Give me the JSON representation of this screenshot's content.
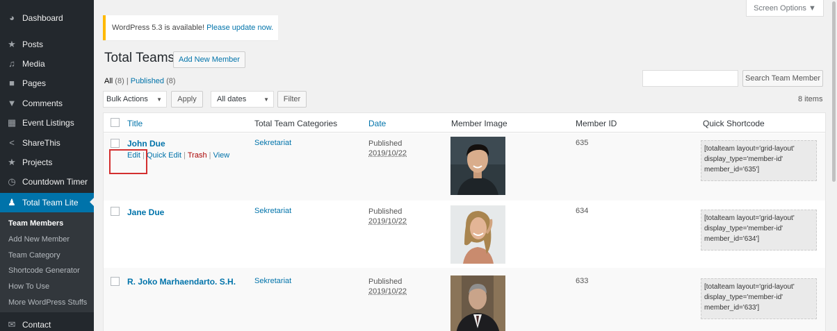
{
  "sidebar": {
    "items": [
      {
        "label": "Dashboard",
        "icon": "dashboard-icon",
        "glyph": "◕"
      },
      {
        "label": "Posts",
        "icon": "pin-icon",
        "glyph": "★"
      },
      {
        "label": "Media",
        "icon": "media-icon",
        "glyph": "♫"
      },
      {
        "label": "Pages",
        "icon": "pages-icon",
        "glyph": "■"
      },
      {
        "label": "Comments",
        "icon": "comment-icon",
        "glyph": "▼"
      },
      {
        "label": "Event Listings",
        "icon": "calendar-icon",
        "glyph": "▦"
      },
      {
        "label": "ShareThis",
        "icon": "share-icon",
        "glyph": "<"
      },
      {
        "label": "Projects",
        "icon": "pin-icon",
        "glyph": "★"
      },
      {
        "label": "Countdown Timer",
        "icon": "clock-icon",
        "glyph": "◷"
      },
      {
        "label": "Total Team Lite",
        "icon": "user-icon",
        "glyph": "♟"
      }
    ],
    "submenu": [
      "Team Members",
      "Add New Member",
      "Team Category",
      "Shortcode Generator",
      "How To Use",
      "More WordPress Stuffs"
    ],
    "bottom": {
      "label": "Contact",
      "icon": "mail-icon",
      "glyph": "✉"
    }
  },
  "screen_options": "Screen Options ▼",
  "notice": {
    "text": "WordPress 5.3 is available!",
    "link": "Please update now."
  },
  "header": {
    "title": "Total Teams",
    "add_new": "Add New Member"
  },
  "filters": {
    "all": "All",
    "all_count": "(8)",
    "separator": "|",
    "published": "Published",
    "published_count": "(8)",
    "bulk_actions": "Bulk Actions",
    "apply": "Apply",
    "all_dates": "All dates",
    "filter": "Filter",
    "search_button": "Search Team Member",
    "search_value": "",
    "items_count": "8 items"
  },
  "columns": {
    "title": "Title",
    "categories": "Total Team Categories",
    "date": "Date",
    "image": "Member Image",
    "id": "Member ID",
    "shortcode": "Quick Shortcode"
  },
  "row_actions": {
    "edit": "Edit",
    "quick_edit": "Quick Edit",
    "trash": "Trash",
    "view": "View",
    "sep": "|"
  },
  "rows": [
    {
      "name": "John Due",
      "category": "Sekretariat",
      "status": "Published",
      "date": "2019/10/22",
      "member_id": "635",
      "shortcode": "[totalteam layout='grid-layout' display_type='member-id' member_id='635']",
      "photo": "young-man-photo"
    },
    {
      "name": "Jane Due",
      "category": "Sekretariat",
      "status": "Published",
      "date": "2019/10/22",
      "member_id": "634",
      "shortcode": "[totalteam layout='grid-layout' display_type='member-id' member_id='634']",
      "photo": "woman-photo"
    },
    {
      "name": "R. Joko Marhaendarto. S.H.",
      "category": "Sekretariat",
      "status": "Published",
      "date": "2019/10/22",
      "member_id": "633",
      "shortcode": "[totalteam layout='grid-layout' display_type='member-id' member_id='633']",
      "photo": "man-suit-photo"
    }
  ],
  "colors": {
    "sidebar_bg": "#23282d",
    "active": "#0073aa",
    "link": "#0073aa",
    "highlight": "#d32f2f"
  }
}
